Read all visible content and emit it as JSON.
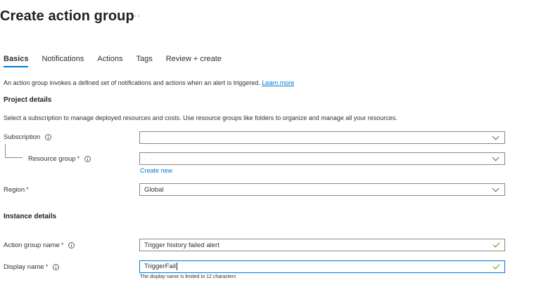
{
  "header": {
    "title": "Create action group",
    "more": "···"
  },
  "tabs": [
    {
      "label": "Basics"
    },
    {
      "label": "Notifications"
    },
    {
      "label": "Actions"
    },
    {
      "label": "Tags"
    },
    {
      "label": "Review + create"
    }
  ],
  "intro": {
    "text": "An action group invokes a defined set of notifications and actions when an alert is triggered.",
    "link": "Learn more"
  },
  "project": {
    "heading": "Project details",
    "description": "Select a subscription to manage deployed resources and costs. Use resource groups like folders to organize and manage all your resources."
  },
  "subscription": {
    "label": "Subscription",
    "value": "·"
  },
  "resource_group": {
    "label": "Resource group",
    "required": "*",
    "value": "·  ·    ·  ·  ·  ·",
    "create_new": "Create new"
  },
  "region": {
    "label": "Region",
    "required": "*",
    "value": "Global"
  },
  "instance": {
    "heading": "Instance details"
  },
  "action_group_name": {
    "label": "Action group name",
    "required": "*",
    "value": "Trigger history failed alert"
  },
  "display_name": {
    "label": "Display name",
    "required": "*",
    "value": "TriggerFail",
    "hint": "The display name is limited to 12 characters"
  },
  "colors": {
    "accent": "#0078d4",
    "required": "#a4262c",
    "valid": "#57a300"
  },
  "icons": {
    "more": "more-icon",
    "info": "info-icon",
    "dropdown": "chevron-down-icon",
    "valid": "checkmark-icon"
  }
}
